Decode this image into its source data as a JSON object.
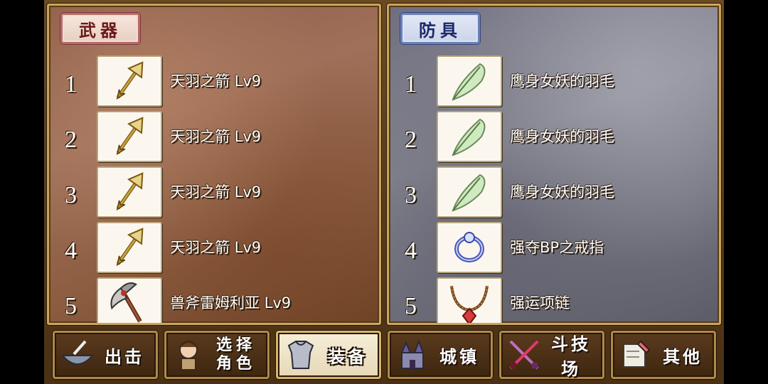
{
  "weapons": {
    "header": "武器",
    "items": [
      {
        "num": "1",
        "name": "天羽之箭 Lv9",
        "icon": "arrow-icon"
      },
      {
        "num": "2",
        "name": "天羽之箭 Lv9",
        "icon": "arrow-icon"
      },
      {
        "num": "3",
        "name": "天羽之箭 Lv9",
        "icon": "arrow-icon"
      },
      {
        "num": "4",
        "name": "天羽之箭 Lv9",
        "icon": "arrow-icon"
      },
      {
        "num": "5",
        "name": "兽斧雷姆利亚 Lv9",
        "icon": "axe-icon"
      }
    ]
  },
  "armor": {
    "header": "防具",
    "items": [
      {
        "num": "1",
        "name": "鹰身女妖的羽毛",
        "icon": "feather-icon"
      },
      {
        "num": "2",
        "name": "鹰身女妖的羽毛",
        "icon": "feather-icon"
      },
      {
        "num": "3",
        "name": "鹰身女妖的羽毛",
        "icon": "feather-icon"
      },
      {
        "num": "4",
        "name": "强夺BP之戒指",
        "icon": "ring-icon"
      },
      {
        "num": "5",
        "name": "强运项链",
        "icon": "necklace-icon"
      }
    ]
  },
  "nav": {
    "sortie": "出击",
    "select_line1": "选择",
    "select_line2": "角色",
    "equip": "装备",
    "town": "城镇",
    "arena": "斗技场",
    "other": "其他"
  },
  "colors": {
    "weapons_panel": "#8c5c40",
    "armor_panel": "#7a7a86",
    "frame_gold": "#c9a560"
  }
}
